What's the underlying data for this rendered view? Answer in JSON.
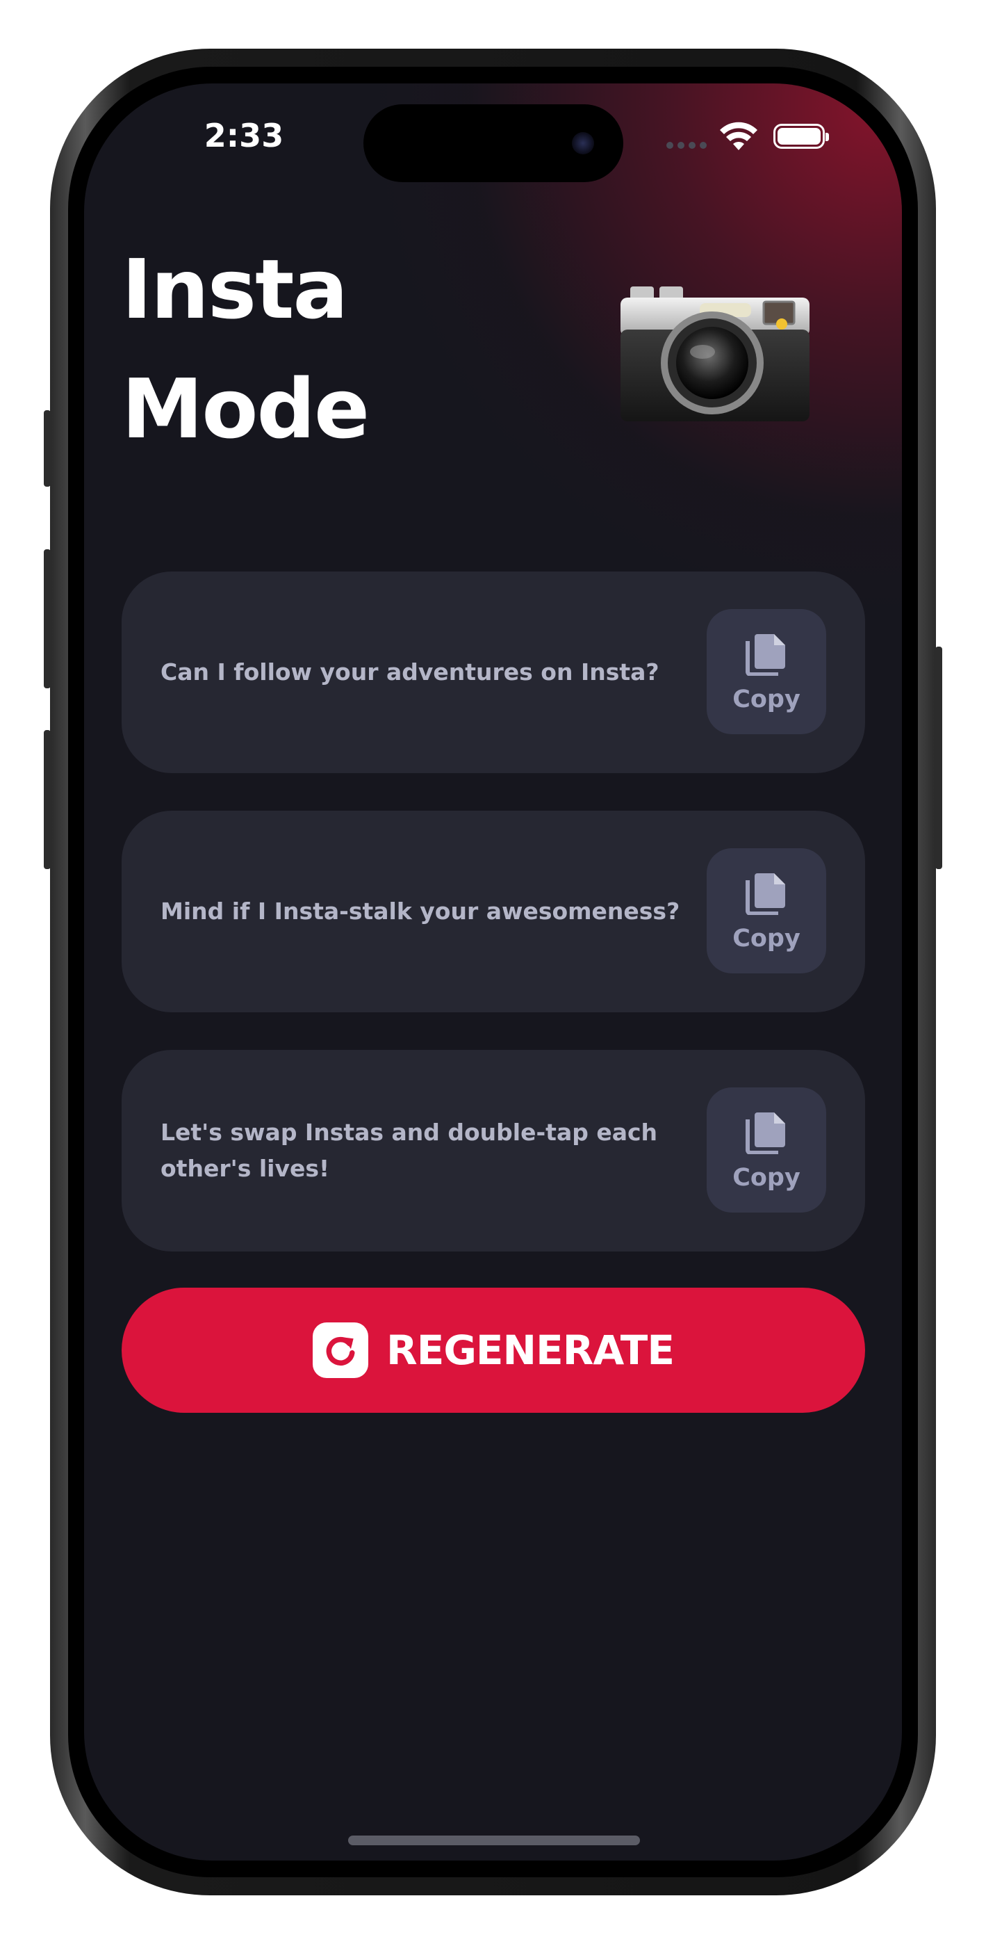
{
  "status_bar": {
    "time": "2:33"
  },
  "header": {
    "title_line1": "Insta",
    "title_line2": "Mode",
    "emoji": "camera-emoji"
  },
  "cards": [
    {
      "text": "Can I follow your adventures on Insta?",
      "copy_label": "Copy"
    },
    {
      "text": "Mind if I Insta-stalk your awesomeness?",
      "copy_label": "Copy"
    },
    {
      "text": "Let's swap Instas and double-tap each other's lives!",
      "copy_label": "Copy"
    }
  ],
  "regenerate": {
    "label": "REGENERATE",
    "icon": "refresh-icon"
  },
  "colors": {
    "background": "#16161e",
    "card": "#262732",
    "copy_button": "#343648",
    "accent": "#db143c",
    "text_muted": "#b4b6c8"
  }
}
